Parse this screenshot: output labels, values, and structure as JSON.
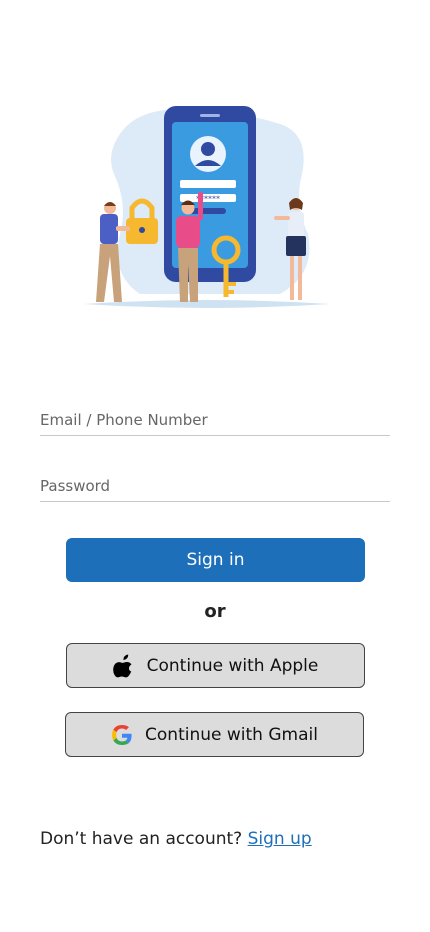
{
  "form": {
    "email_placeholder": "Email / Phone Number",
    "password_placeholder": "Password",
    "password_mask": "******",
    "signin_label": "Sign in",
    "divider_text": "or",
    "apple_label": "Continue with Apple",
    "gmail_label": "Continue with Gmail"
  },
  "footer": {
    "prompt": "Don’t have an account?",
    "signup_link": "Sign up"
  },
  "icons": {
    "apple": "apple-icon",
    "google": "google-icon"
  },
  "colors": {
    "primary": "#1d6fba",
    "social_bg": "#dcdcdc",
    "illustration_bg": "#dcebf7"
  }
}
